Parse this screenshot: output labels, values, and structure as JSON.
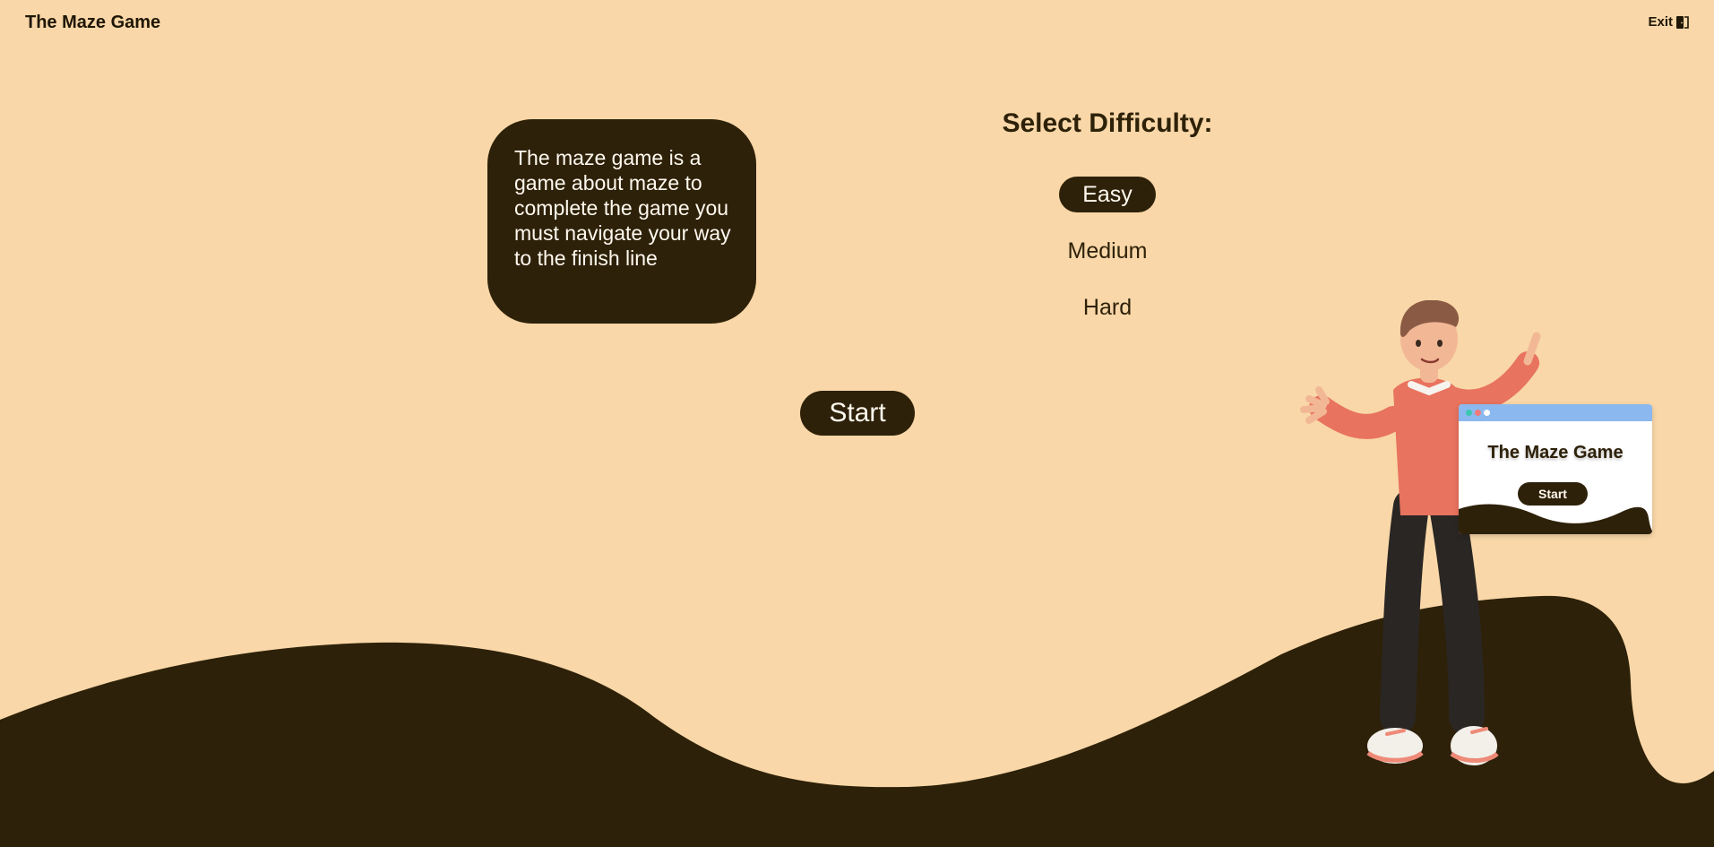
{
  "header": {
    "app_title": "The Maze Game",
    "exit_label": "Exit"
  },
  "description": {
    "text": "The maze game is a game about maze to complete the game you must navigate your way to the finish line"
  },
  "difficulty": {
    "title": "Select Difficulty:",
    "options": [
      {
        "label": "Easy",
        "selected": true
      },
      {
        "label": "Medium",
        "selected": false
      },
      {
        "label": "Hard",
        "selected": false
      }
    ]
  },
  "start_label": "Start",
  "illustration": {
    "icon": "person-presenting-illustration",
    "window_title": "The Maze Game",
    "window_button": "Start"
  },
  "colors": {
    "background": "#f9d7a8",
    "dark_brown": "#2e2109",
    "text_light": "#fff9ef",
    "window_bar": "#8bb8ef"
  }
}
